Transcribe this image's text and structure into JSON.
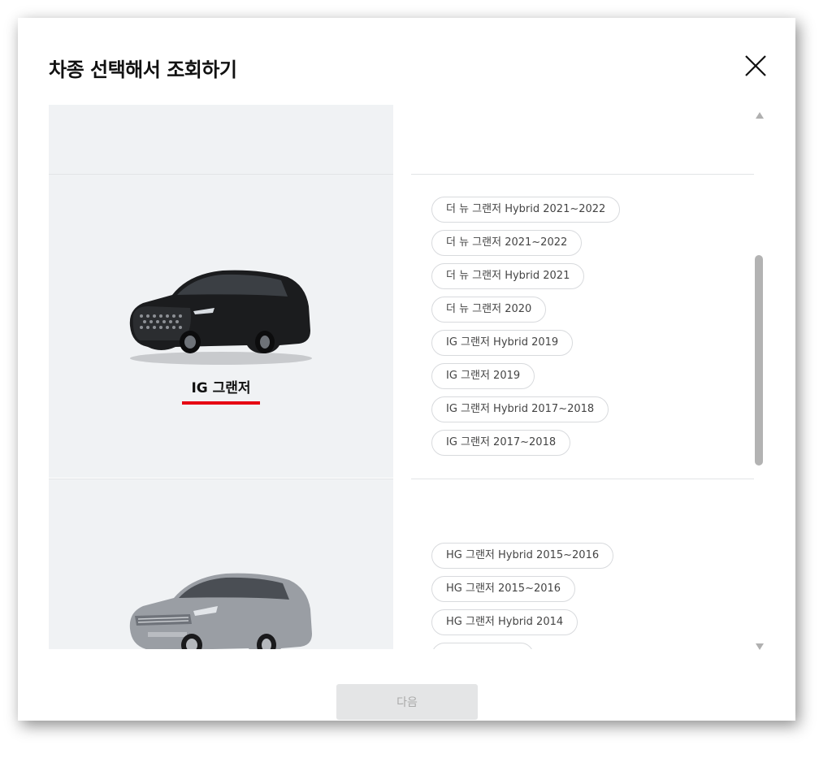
{
  "modal": {
    "title": "차종 선택해서 조회하기",
    "next_label": "다음"
  },
  "groups": [
    {
      "name": "IG 그랜저",
      "selected": true,
      "trims": [
        "더 뉴 그랜저 Hybrid 2021~2022",
        "더 뉴 그랜저 2021~2022",
        "더 뉴 그랜저 Hybrid 2021",
        "더 뉴 그랜저 2020",
        "IG 그랜저 Hybrid 2019",
        "IG 그랜저 2019",
        "IG 그랜저 Hybrid 2017~2018",
        "IG 그랜저 2017~2018"
      ]
    },
    {
      "name": "",
      "trims": [
        "HG 그랜저 Hybrid 2015~2016",
        "HG 그랜저 2015~2016",
        "HG 그랜저 Hybrid 2014"
      ]
    }
  ],
  "colors": {
    "accent": "#e60012",
    "panel": "#f0f2f4",
    "chip_border": "#d8dadd"
  }
}
